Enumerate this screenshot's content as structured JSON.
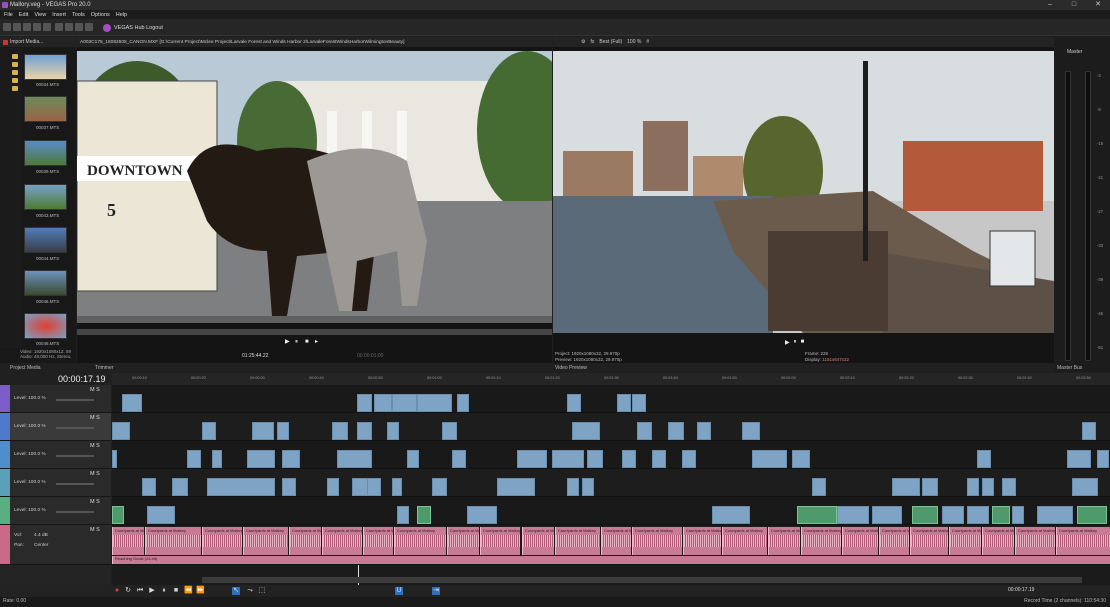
{
  "window": {
    "title": "Mallory.veg - VEGAS Pro 20.0"
  },
  "menu": [
    "File",
    "Edit",
    "View",
    "Insert",
    "Tools",
    "Options",
    "Help"
  ],
  "hub": {
    "label": "VEGAS Hub Logout"
  },
  "project_media": {
    "header": "Import Media...",
    "thumbs": [
      "00034.MTS",
      "00037.MTS",
      "00039.MTS",
      "00043.MTS",
      "00044.MTS",
      "00046.MTS",
      "00048.MTS"
    ],
    "info_video": "Video: 1920x1080x12, 59",
    "info_audio": "Audio: 48,000 Hz, Stereo,",
    "tabs": [
      "Project Media",
      "Trimmer"
    ]
  },
  "trimmer": {
    "path": "A003C175_16082608_CANON.MXF   [G:\\Current Project\\Mclee Project\\Larvale Forest and Winds Harbor 2\\LarvaleForestWindsHarborWilmingtonBeauty]",
    "timecode": "01:25:44.22",
    "timecode2": "00:00:01;00"
  },
  "preview": {
    "quality": "Best (Full)",
    "zoom": "100 %",
    "project": "Project:  1920x1080x32, 29.970p",
    "preview": "Preview:  1920x1080x32, 29.970p",
    "display": "Display:  1151x647x32",
    "frame_label": "Frame:",
    "frame": "225",
    "display_label": "Display:",
    "display_val": "1151x647x32",
    "tab": "Video Preview"
  },
  "master": {
    "label": "Master",
    "tab": "Master Bus",
    "scale": [
      "-3",
      "-6",
      "-9",
      "-12",
      "-15",
      "-18",
      "-21",
      "-24",
      "-27",
      "-30",
      "-33",
      "-36",
      "-39",
      "-42",
      "-45",
      "-48",
      "-51",
      "-54",
      "-57"
    ]
  },
  "timeline": {
    "timecode": "00:00:17.19",
    "ruler": [
      "00:00:10",
      "00:00:20",
      "00:00:30",
      "00:00:40",
      "00:00:50",
      "00:01:00",
      "00:01:10",
      "00:01:20",
      "00:01:30",
      "00:01:40",
      "00:01:50",
      "00:02:00",
      "00:02:10",
      "00:02:20",
      "00:02:30",
      "00:02:40",
      "00:02:50"
    ],
    "tracks": [
      {
        "level": "Level: 100.0 %"
      },
      {
        "level": "Level: 100.0 %"
      },
      {
        "level": "Level: 100.0 %"
      },
      {
        "level": "Level: 100.0 %"
      },
      {
        "level": "Level: 100.0 %"
      }
    ],
    "audio": {
      "vol_label": "Vol:",
      "vol": "4.4 dB",
      "pan_label": "Pan:",
      "pan": "Center",
      "clip_label": "Courtyards at Mallory",
      "bottom_label": "Reaching Goals (24-bit)"
    },
    "ms": "M  S"
  },
  "transport": {
    "timecode": "00:00:17.19"
  },
  "status": {
    "rate": "Rate: 0.00",
    "record": "Record Time (2 channels): 110:54:30"
  },
  "colors": {
    "video_clip": "#7ea3c4",
    "audio_clip": "#c97a95",
    "accent": "#9a4fc0"
  }
}
